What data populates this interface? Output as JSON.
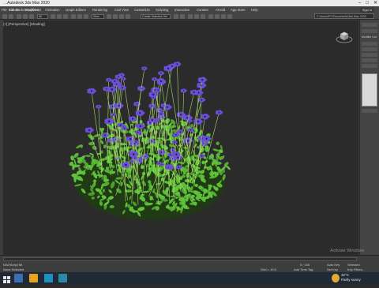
{
  "titlebar": {
    "title": "...Autodesk 3ds Max 2020"
  },
  "menu": {
    "items": [
      "File",
      "Edit",
      "Tools",
      "Group",
      "Views",
      "Create",
      "Modifiers",
      "Animation",
      "Graph Editors",
      "Rendering",
      "Civil View",
      "Customize",
      "Scripting",
      "Interactive",
      "Content",
      "Arnold",
      "App Store",
      "Help"
    ]
  },
  "account": {
    "signin_label": "Sign In"
  },
  "toolbar": {
    "filter_value": "All",
    "view_value": "View",
    "selection_set_value": "Create Selection Set",
    "workspace_path": "C:\\Users\\PC\\Documents\\3ds Max 2020"
  },
  "viewport": {
    "label": "[+] [Perspective] [Shading]"
  },
  "command_panel": {
    "modifier_list_label": "Modifier List"
  },
  "status": {
    "selection_info": "None Selected",
    "time_readout": "0 / 100",
    "coords_label": "X: Y: Z:",
    "grid_label": "Grid = 10.0",
    "add_time_tag": "Add Time Tag",
    "auto_key": "Auto Key",
    "set_key": "Set Key",
    "selected": "Selected",
    "key_filters": "Key Filters..."
  },
  "watermark": {
    "line1": "Activate Windows",
    "line2": "Go to Settings to activate Windows."
  },
  "taskbar": {
    "weather_temp": "32°C",
    "weather_text": "Partly sunny"
  },
  "colors": {
    "flower_petal": "#6b4fd6",
    "leaf": "#5fc23a",
    "viewport_bg": "#2b2b2b"
  }
}
